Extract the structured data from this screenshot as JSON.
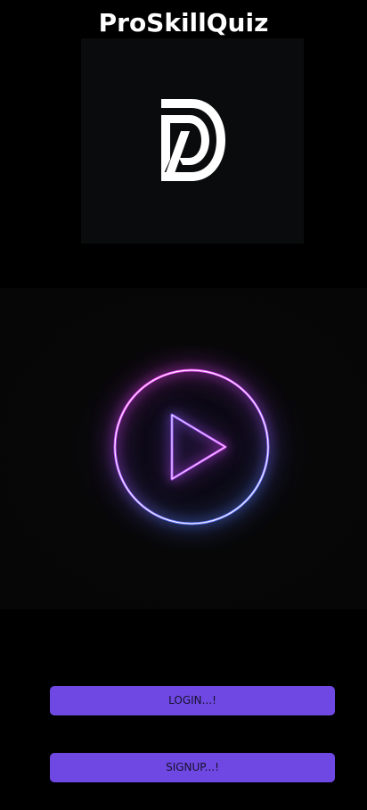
{
  "app": {
    "title": "ProSkillQuiz"
  },
  "logo": {
    "icon": "d-brand-logo-icon",
    "background": "#0a0b0c",
    "color": "#ffffff"
  },
  "hero": {
    "icon": "neon-play-icon",
    "colors": [
      "#ff3cf0",
      "#8a5cff",
      "#5a7dff"
    ]
  },
  "actions": {
    "login_label": "LOGIN...!",
    "signup_label": "SIGNUP...!",
    "button_color": "#6f48e3"
  }
}
